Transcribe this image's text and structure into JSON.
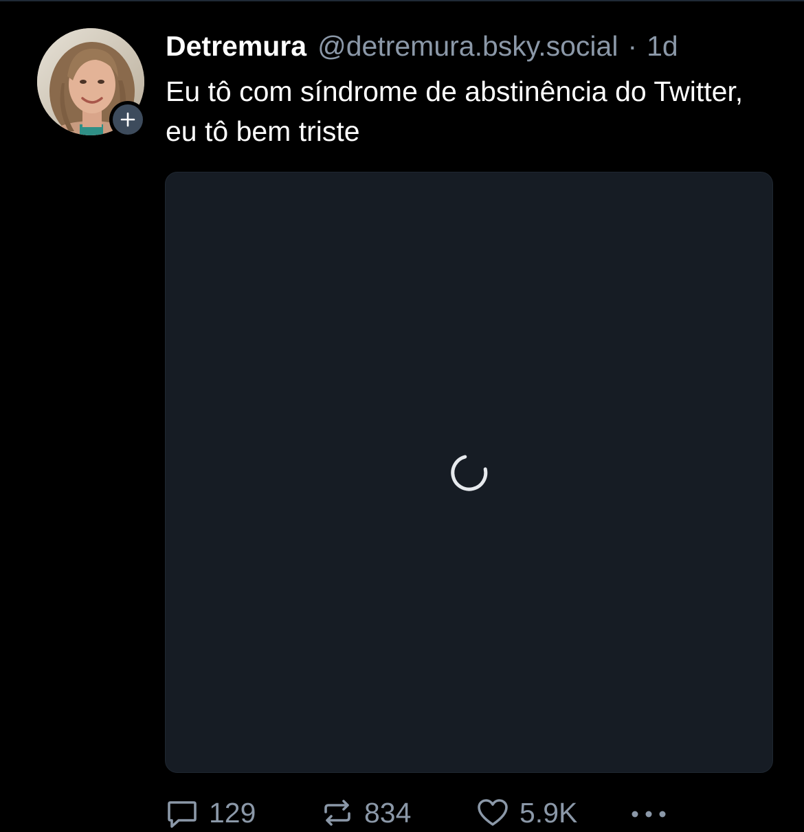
{
  "post": {
    "author": {
      "display_name": "Detremura",
      "handle": "@detremura.bsky.social",
      "avatar_icon": "avatar-photo",
      "follow_badge_icon": "plus-icon"
    },
    "separator": "·",
    "time": "1d",
    "text": "Eu tô com síndrome de abstinência do Twitter, eu tô bem triste",
    "media": {
      "state": "loading",
      "icon": "loading-spinner-icon"
    },
    "actions": {
      "reply": {
        "icon": "reply-icon",
        "count": "129"
      },
      "repost": {
        "icon": "repost-icon",
        "count": "834"
      },
      "like": {
        "icon": "heart-icon",
        "count": "5.9K"
      },
      "more": {
        "icon": "more-options-icon"
      }
    }
  },
  "colors": {
    "background": "#000000",
    "media_background": "#161c24",
    "secondary_text": "#8b98a8",
    "badge": "#3d4b5c"
  }
}
